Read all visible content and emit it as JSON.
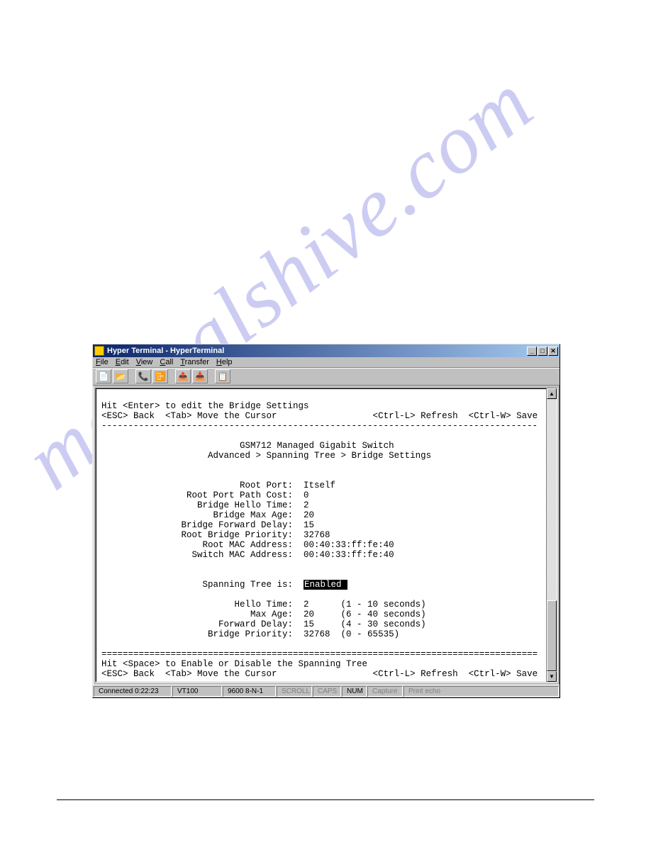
{
  "watermark": "manualshive.com",
  "window": {
    "title": "Hyper Terminal - HyperTerminal",
    "menus": [
      "File",
      "Edit",
      "View",
      "Call",
      "Transfer",
      "Help"
    ],
    "toolbar_icons": [
      "new",
      "open",
      "|",
      "connect",
      "disconnect",
      "|",
      "send",
      "receive",
      "|",
      "properties"
    ]
  },
  "terminal": {
    "top_hint1": "Hit <Enter> to edit the Bridge Settings",
    "top_hint2_left": "<ESC> Back  <Tab> Move the Cursor",
    "top_hint2_right": "<Ctrl-L> Refresh  <Ctrl-W> Save",
    "device_title": "GSM712 Managed Gigabit Switch",
    "breadcrumb": "Advanced > Spanning Tree > Bridge Settings",
    "fields": [
      {
        "label": "Root Port:",
        "value": "Itself"
      },
      {
        "label": "Root Port Path Cost:",
        "value": "0"
      },
      {
        "label": "Bridge Hello Time:",
        "value": "2"
      },
      {
        "label": "Bridge Max Age:",
        "value": "20"
      },
      {
        "label": "Bridge Forward Delay:",
        "value": "15"
      },
      {
        "label": "Root Bridge Priority:",
        "value": "32768"
      },
      {
        "label": "Root MAC Address:",
        "value": "00:40:33:ff:fe:40"
      },
      {
        "label": "Switch MAC Address:",
        "value": "00:40:33:ff:fe:40"
      }
    ],
    "spanning_label": "Spanning Tree is:",
    "spanning_value": "Enabled",
    "settings": [
      {
        "label": "Hello Time:",
        "value": "2",
        "range": "(1 - 10 seconds)"
      },
      {
        "label": "Max Age:",
        "value": "20",
        "range": "(6 - 40 seconds)"
      },
      {
        "label": "Forward Delay:",
        "value": "15",
        "range": "(4 - 30 seconds)"
      },
      {
        "label": "Bridge Priority:",
        "value": "32768",
        "range": "(0 - 65535)"
      }
    ],
    "bottom_hint1": "Hit <Space> to Enable or Disable the Spanning Tree",
    "bottom_hint2_left": "<ESC> Back  <Tab> Move the Cursor",
    "bottom_hint2_right": "<Ctrl-L> Refresh  <Ctrl-W> Save"
  },
  "statusbar": {
    "connected": "Connected 0:22:23",
    "emulation": "VT100",
    "params": "9600 8-N-1",
    "scroll": "SCROLL",
    "caps": "CAPS",
    "num": "NUM",
    "capture": "Capture",
    "printecho": "Print echo"
  }
}
